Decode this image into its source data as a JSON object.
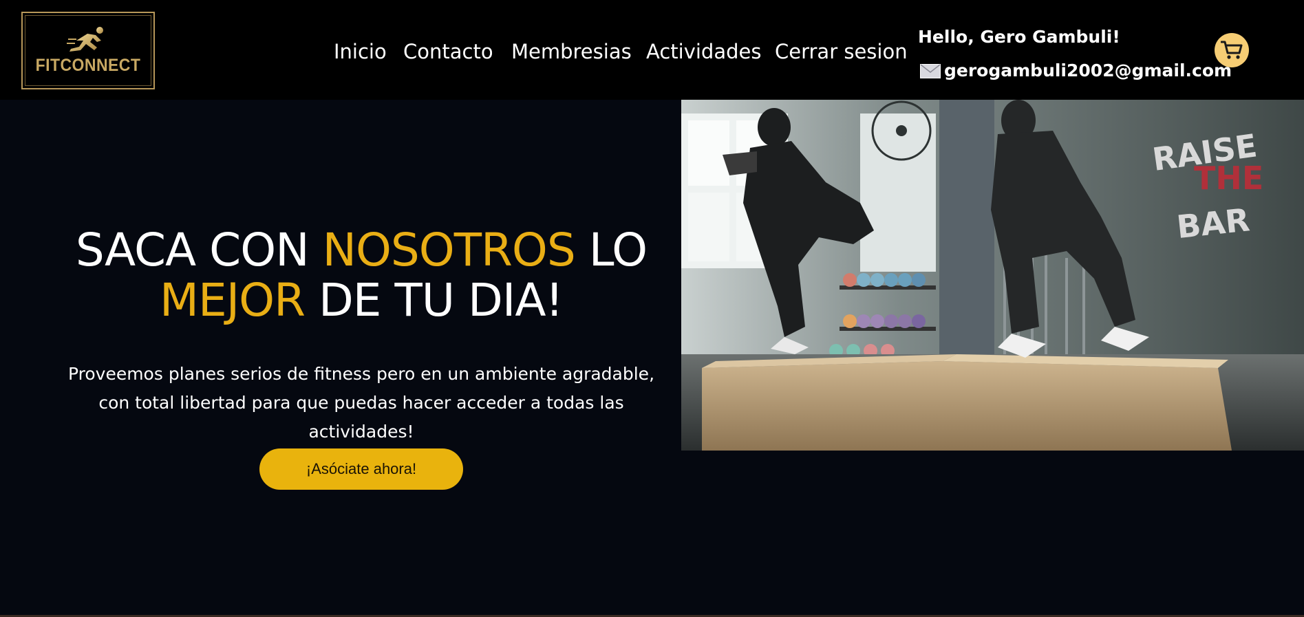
{
  "brand": {
    "name": "FITCONNECT",
    "colors": {
      "gold": "#c9a963",
      "accent": "#e9ae15",
      "button": "#e9b30d",
      "cart": "#f6cd74"
    }
  },
  "nav": [
    {
      "label": "Inicio"
    },
    {
      "label": "Contacto"
    },
    {
      "label": "Membresias"
    },
    {
      "label": "Actividades"
    },
    {
      "label": "Cerrar sesion"
    }
  ],
  "user": {
    "greeting": "Hello, Gero Gambuli!",
    "email": "gerogambuli2002@gmail.com",
    "mail_icon": "envelope-icon"
  },
  "cart": {
    "icon": "shopping-cart-icon"
  },
  "hero": {
    "title_part1": "SACA CON ",
    "title_accent1": "NOSOTROS",
    "title_part2": " LO",
    "title_accent2": "MEJOR",
    "title_part3": " DE TU DIA!",
    "description": "Proveemos planes serios de fitness pero en un ambiente agradable, con total libertad para que puedas hacer acceder a todas las actividades!",
    "cta_label": "¡Asóciate ahora!"
  },
  "photo": {
    "wall_text": [
      "RAISE",
      "THE",
      "BAR"
    ]
  }
}
